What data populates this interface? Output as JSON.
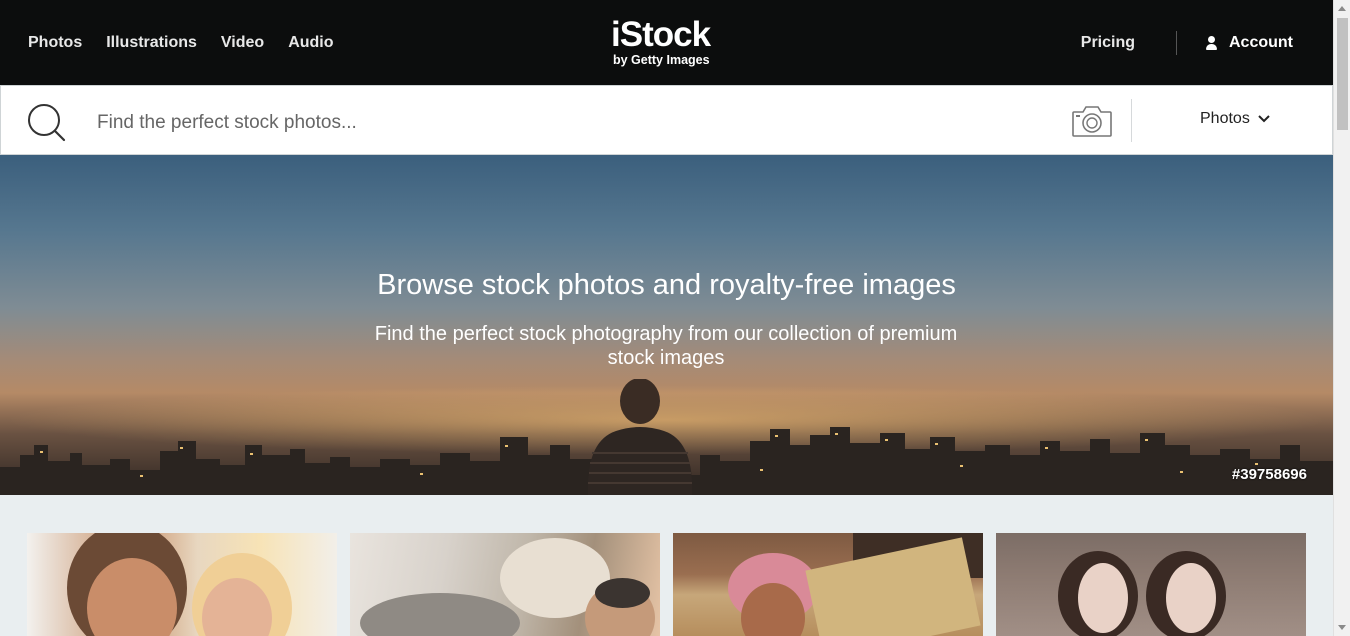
{
  "nav": {
    "links": [
      "Photos",
      "Illustrations",
      "Video",
      "Audio"
    ],
    "logo_main": "iStock",
    "logo_sub": "by Getty Images",
    "pricing": "Pricing",
    "account": "Account"
  },
  "search": {
    "placeholder": "Find the perfect stock photos...",
    "type_selected": "Photos"
  },
  "hero": {
    "title": "Browse stock photos and royalty-free images",
    "subtitle": "Find the perfect stock photography from our collection of premium stock images",
    "image_id": "#39758696"
  },
  "colors": {
    "nav_bg": "#0c0d0d",
    "page_bg": "#e9eef0",
    "text_white": "#ffffff"
  }
}
